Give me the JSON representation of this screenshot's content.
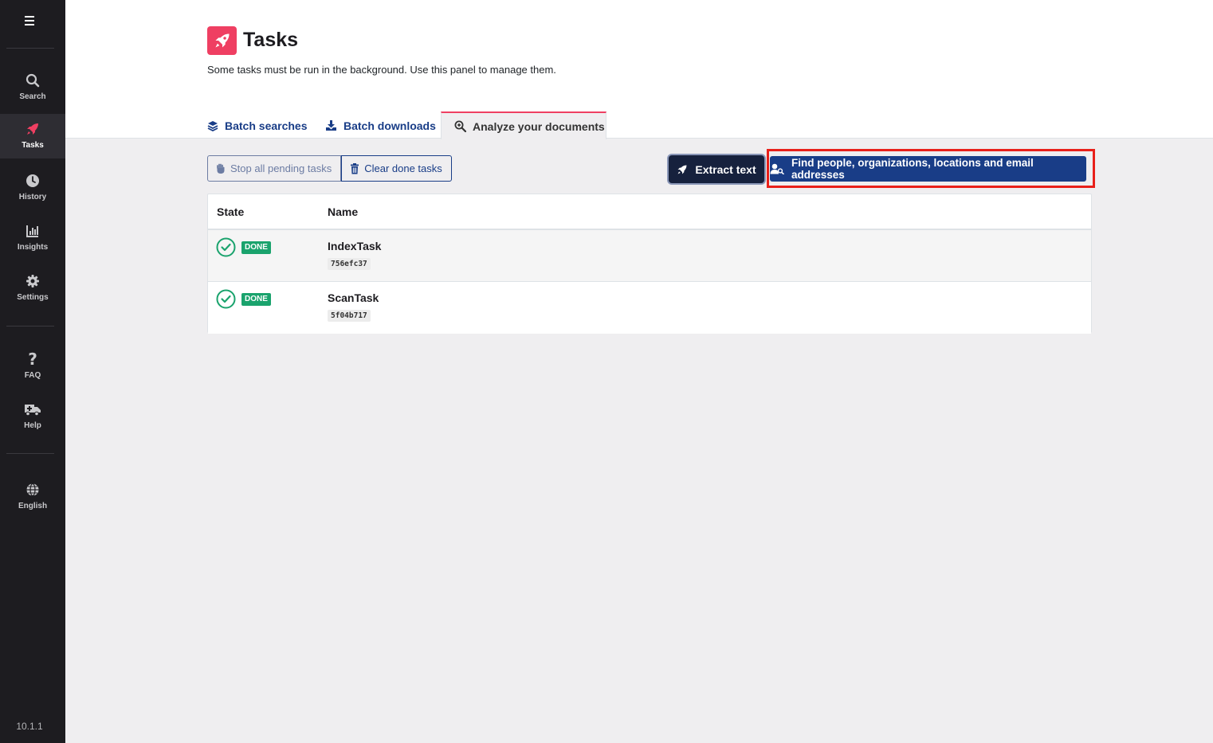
{
  "sidebar": {
    "items": [
      {
        "label": "Search",
        "icon": "search-icon"
      },
      {
        "label": "Tasks",
        "icon": "rocket-icon",
        "active": true
      },
      {
        "label": "History",
        "icon": "clock-icon"
      },
      {
        "label": "Insights",
        "icon": "chart-icon"
      },
      {
        "label": "Settings",
        "icon": "gear-icon"
      },
      {
        "label": "FAQ",
        "icon": "question-icon"
      },
      {
        "label": "Help",
        "icon": "ambulance-icon"
      },
      {
        "label": "English",
        "icon": "globe-icon"
      }
    ],
    "version": "10.1.1"
  },
  "header": {
    "title": "Tasks",
    "description": "Some tasks must be run in the background. Use this panel to manage them."
  },
  "tabs": [
    {
      "label": "Batch searches",
      "icon": "layers-icon"
    },
    {
      "label": "Batch downloads",
      "icon": "download-icon"
    },
    {
      "label": "Analyze your documents",
      "icon": "search-plus-icon",
      "active": true
    }
  ],
  "toolbar": {
    "stop_label": "Stop all pending tasks",
    "clear_label": "Clear done tasks",
    "extract_label": "Extract text",
    "find_label": "Find people, organizations, locations and email addresses"
  },
  "table": {
    "columns": [
      "State",
      "Name"
    ],
    "rows": [
      {
        "state": "DONE",
        "name": "IndexTask",
        "id": "756efc37"
      },
      {
        "state": "DONE",
        "name": "ScanTask",
        "id": "5f04b717"
      }
    ]
  },
  "colors": {
    "accent": "#ef3f62",
    "primary": "#193d87",
    "success": "#1aa36d",
    "sidebar": "#1d1c20",
    "highlight": "#e8201a"
  }
}
